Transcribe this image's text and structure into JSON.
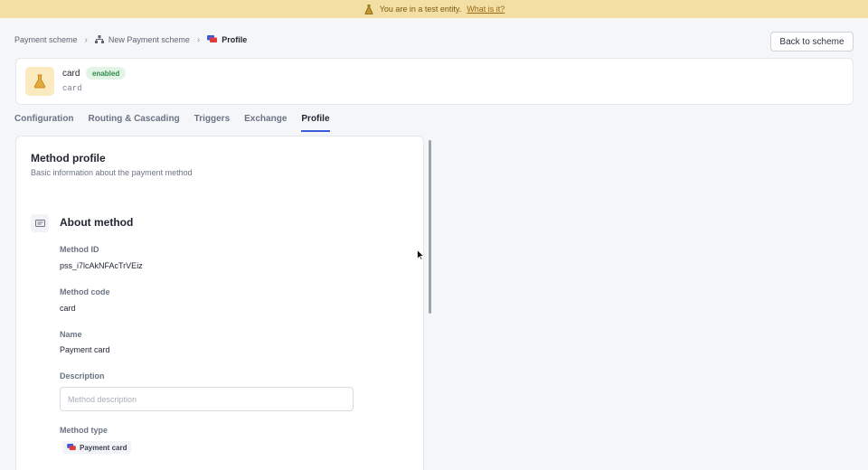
{
  "banner": {
    "text": "You are in a test entity.",
    "link": "What is it?",
    "color": "#f3dfa3"
  },
  "breadcrumb": {
    "items": [
      {
        "label": "Payment scheme",
        "icon": ""
      },
      {
        "label": "New Payment scheme",
        "icon": "hierarchy-icon"
      },
      {
        "label": "Profile",
        "icon": "card-icon"
      }
    ]
  },
  "header": {
    "back_button": "Back to scheme",
    "title": "card",
    "status": "enabled",
    "subtitle": "card",
    "avatar_icon": "flask-icon"
  },
  "tabs": [
    {
      "label": "Configuration",
      "active": false
    },
    {
      "label": "Routing & Cascading",
      "active": false
    },
    {
      "label": "Triggers",
      "active": false
    },
    {
      "label": "Exchange",
      "active": false
    },
    {
      "label": "Profile",
      "active": true
    }
  ],
  "panel": {
    "title": "Method profile",
    "subtitle": "Basic information about the payment method",
    "section_title": "About method",
    "section_icon": "id-card-icon",
    "fields": {
      "method_id_label": "Method ID",
      "method_id_value": "pss_i7lcAkNFAcTrVEiz",
      "method_code_label": "Method code",
      "method_code_value": "card",
      "name_label": "Name",
      "name_value": "Payment card",
      "description_label": "Description",
      "description_value": "",
      "description_placeholder": "Method description",
      "method_type_label": "Method type",
      "method_type_value": "Payment card"
    }
  },
  "colors": {
    "accent": "#3b5bdb",
    "enabled_badge_bg": "#e3f4e6",
    "enabled_badge_fg": "#2f8a46"
  }
}
